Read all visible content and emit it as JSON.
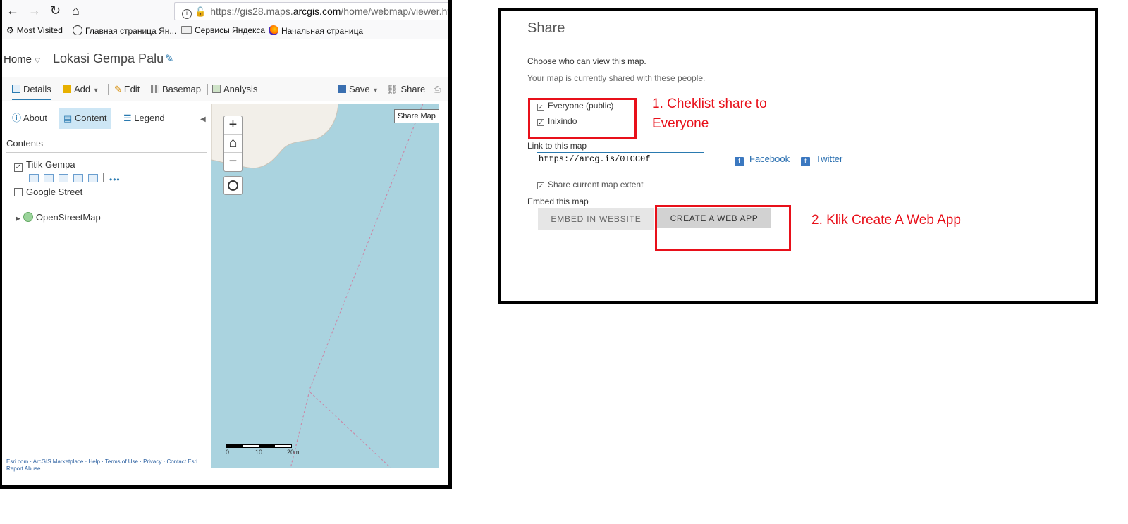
{
  "browser": {
    "url_prefix": "https://gis28.maps.",
    "url_host": "arcgis.com",
    "url_path": "/home/webmap/viewer.htm",
    "bookmarks": [
      "Most Visited",
      "Главная страница Ян...",
      "Сервисы Яндекса",
      "Начальная страница"
    ]
  },
  "app": {
    "home_label": "Home",
    "map_title": "Lokasi Gempa Palu",
    "toolbar": {
      "details": "Details",
      "add": "Add",
      "edit": "Edit",
      "basemap": "Basemap",
      "analysis": "Analysis",
      "save": "Save",
      "share": "Share"
    },
    "side_tabs": {
      "about": "About",
      "content": "Content",
      "legend": "Legend"
    },
    "contents_heading": "Contents",
    "layers": [
      {
        "name": "Titik Gempa",
        "checked": true
      },
      {
        "name": "Google Street",
        "checked": false
      },
      {
        "name": "OpenStreetMap",
        "checked": null
      }
    ],
    "footer_links": "Esri.com · ArcGIS Marketplace · Help · Terms of Use · Privacy · Contact Esri · Report Abuse",
    "map": {
      "tooltip": "Share Map",
      "zoom_in": "+",
      "zoom_out": "−",
      "scale_labels": [
        "0",
        "10",
        "20mi"
      ]
    }
  },
  "share_dialog": {
    "title": "Share",
    "choose_heading": "Choose who can view this map.",
    "shared_note": "Your map is currently shared with these people.",
    "options": [
      {
        "label": "Everyone (public)",
        "checked": true
      },
      {
        "label": "Inixindo",
        "checked": true
      }
    ],
    "link_heading": "Link to this map",
    "link_value": "https://arcg.is/0TCC0f",
    "facebook": "Facebook",
    "twitter": "Twitter",
    "share_extent": "Share current map extent",
    "embed_heading": "Embed this map",
    "embed_button": "EMBED IN WEBSITE",
    "webapp_button": "CREATE A WEB APP"
  },
  "annotations": {
    "step1_line1": "1. Cheklist share to",
    "step1_line2": "Everyone",
    "step2": "2. Klik Create A Web App",
    "color": "#e8101a"
  },
  "colors": {
    "water": "#aad3df",
    "land": "#f2efe9",
    "accent": "#2a7ab0"
  }
}
